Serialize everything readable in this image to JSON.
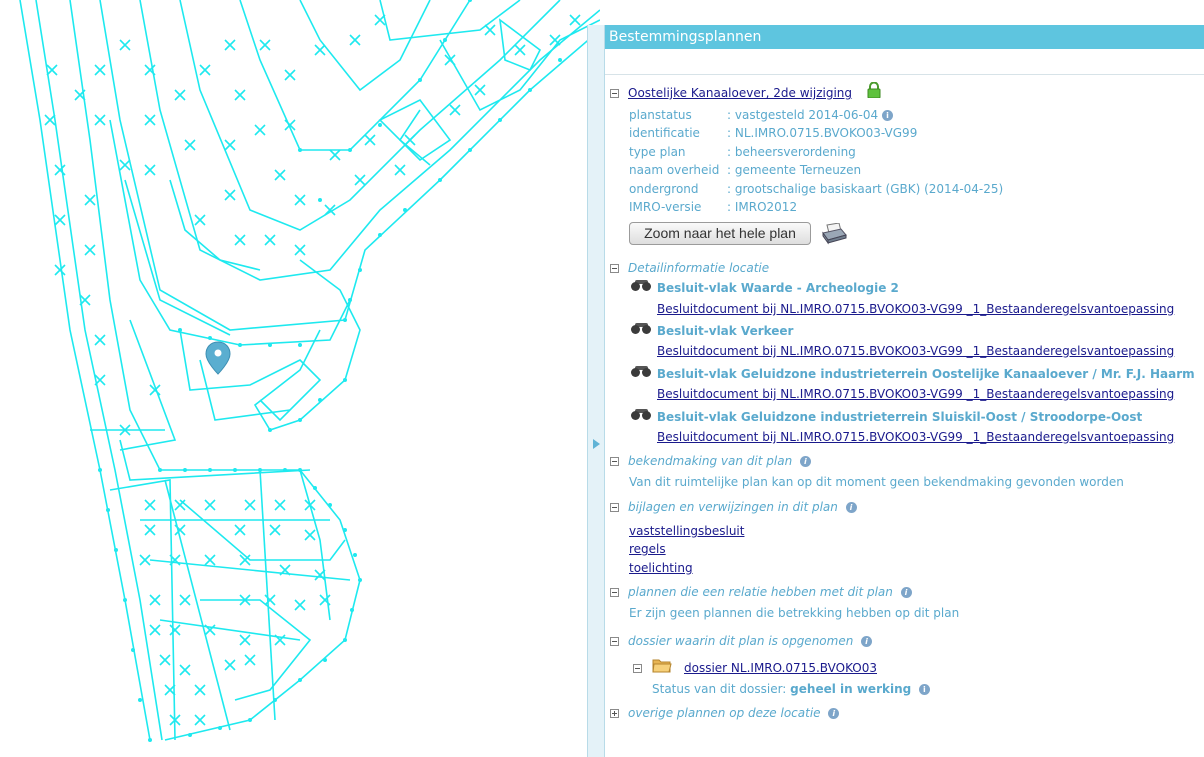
{
  "panel": {
    "title": "Bestemmingsplannen",
    "plan": {
      "name": "Oostelijke Kanaaloever, 2de wijziging",
      "fields": [
        {
          "key": "planstatus",
          "value": ": vastgesteld 2014-06-04"
        },
        {
          "key": "identificatie",
          "value": ": NL.IMRO.0715.BVOKO03-VG99"
        },
        {
          "key": "type plan",
          "value": ": beheersverordening"
        },
        {
          "key": "naam overheid",
          "value": ": gemeente Terneuzen"
        },
        {
          "key": "ondergrond",
          "value": ": grootschalige basiskaart (GBK) (2014-04-25)"
        },
        {
          "key": "IMRO-versie",
          "value": ": IMRO2012"
        }
      ],
      "zoom_button": "Zoom naar het hele plan"
    },
    "detail": {
      "title": "Detailinformatie locatie",
      "items": [
        {
          "title": "Besluit-vlak Waarde - Archeologie 2",
          "link": "Besluitdocument bij NL.IMRO.0715.BVOKO03-VG99 _1_Bestaanderegelsvantoepassing"
        },
        {
          "title": "Besluit-vlak Verkeer",
          "link": "Besluitdocument bij NL.IMRO.0715.BVOKO03-VG99 _1_Bestaanderegelsvantoepassing"
        },
        {
          "title": "Besluit-vlak Geluidzone industrieterrein Oostelijke Kanaaloever / Mr. F.J. Haarm",
          "link": "Besluitdocument bij NL.IMRO.0715.BVOKO03-VG99 _1_Bestaanderegelsvantoepassing"
        },
        {
          "title": "Besluit-vlak Geluidzone industrieterrein Sluiskil-Oost / Stroodorpe-Oost",
          "link": "Besluitdocument bij NL.IMRO.0715.BVOKO03-VG99 _1_Bestaanderegelsvantoepassing"
        }
      ]
    },
    "bekendmaking": {
      "title": "bekendmaking van dit plan",
      "text": "Van dit ruimtelijke plan kan op dit moment geen bekendmaking gevonden worden"
    },
    "bijlagen": {
      "title": "bijlagen en verwijzingen in dit plan",
      "links": [
        "vaststellingsbesluit",
        "regels",
        "toelichting"
      ]
    },
    "relaties": {
      "title": "plannen die een relatie hebben met dit plan",
      "text": "Er zijn geen plannen die betrekking hebben op dit plan"
    },
    "dossier": {
      "title": "dossier waarin dit plan is opgenomen",
      "link": "dossier NL.IMRO.0715.BVOKO03",
      "status_label": "Status van dit dossier:",
      "status_value": "geheel in werking"
    },
    "overige": {
      "title": "overige plannen op deze locatie"
    }
  },
  "icons": {
    "info": "info-icon",
    "lock": "lock-icon",
    "binoculars": "binoculars-icon",
    "printer": "printer-icon",
    "folder": "folder-icon",
    "map_marker": "map-marker-icon"
  },
  "colors": {
    "header": "#5ec5df",
    "map_lines": "#00ffff",
    "label": "#5aa9cd",
    "link": "#1a1a8c"
  }
}
